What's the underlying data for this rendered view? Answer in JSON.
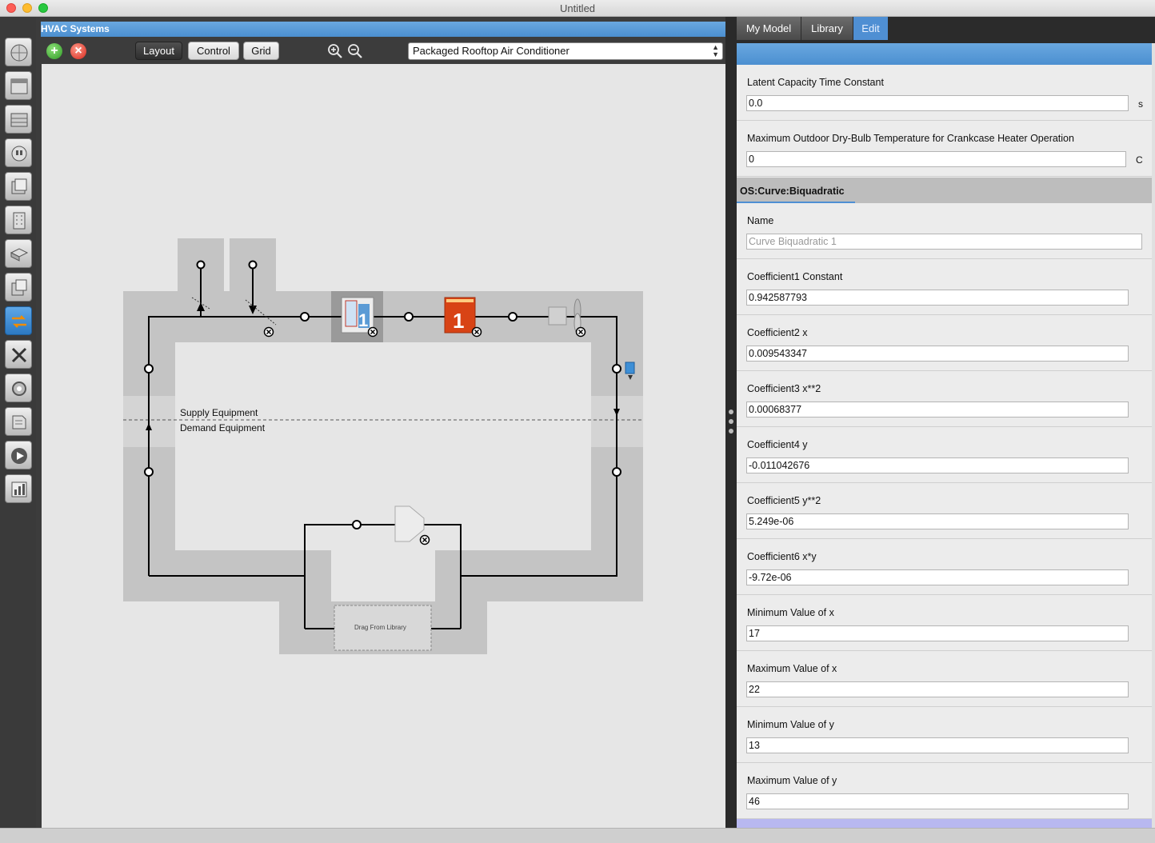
{
  "window": {
    "title": "Untitled"
  },
  "sidebar": {
    "items": [
      {
        "icon": "globe-icon"
      },
      {
        "icon": "calendar-icon"
      },
      {
        "icon": "constructions-icon"
      },
      {
        "icon": "loads-icon"
      },
      {
        "icon": "space-types-icon"
      },
      {
        "icon": "building-icon"
      },
      {
        "icon": "spaces-icon"
      },
      {
        "icon": "thermal-zones-icon"
      },
      {
        "icon": "hvac-systems-icon",
        "active": true
      },
      {
        "icon": "variables-icon"
      },
      {
        "icon": "simulation-settings-icon"
      },
      {
        "icon": "scripts-icon"
      },
      {
        "icon": "run-simulation-icon"
      },
      {
        "icon": "results-icon"
      }
    ]
  },
  "main": {
    "header": "HVAC Systems",
    "toolbar": {
      "add_label": "+",
      "delete_label": "×",
      "layout_label": "Layout",
      "control_label": "Control",
      "grid_label": "Grid",
      "system_select": "Packaged Rooftop Air Conditioner"
    },
    "canvas": {
      "supply_label": "Supply Equipment",
      "demand_label": "Demand Equipment",
      "drop_zone_label": "Drag From Library",
      "component_badge": "1"
    }
  },
  "right_panel": {
    "tabs": [
      "My Model",
      "Library",
      "Edit"
    ],
    "active_tab": "Edit",
    "fields_top": [
      {
        "label": "Latent Capacity Time Constant",
        "value": "0.0",
        "unit": "s"
      },
      {
        "label": "Maximum Outdoor Dry-Bulb Temperature for Crankcase Heater Operation",
        "value": "0",
        "unit": "C"
      }
    ],
    "section_title": "OS:Curve:Biquadratic",
    "name_field": {
      "label": "Name",
      "placeholder": "Curve Biquadratic 1"
    },
    "fields": [
      {
        "label": "Coefficient1 Constant",
        "value": "0.942587793"
      },
      {
        "label": "Coefficient2 x",
        "value": "0.009543347"
      },
      {
        "label": "Coefficient3 x**2",
        "value": "0.00068377"
      },
      {
        "label": "Coefficient4 y",
        "value": "-0.011042676"
      },
      {
        "label": "Coefficient5 y**2",
        "value": "5.249e-06"
      },
      {
        "label": "Coefficient6 x*y",
        "value": "-9.72e-06"
      },
      {
        "label": "Minimum Value of x",
        "value": "17"
      },
      {
        "label": "Maximum Value of x",
        "value": "22"
      },
      {
        "label": "Minimum Value of y",
        "value": "13"
      },
      {
        "label": "Maximum Value of y",
        "value": "46"
      }
    ]
  },
  "colors": {
    "accent_blue": "#4f8fd3",
    "canvas_bg": "#e6e6e6",
    "loop_band": "#c4c4c4"
  }
}
